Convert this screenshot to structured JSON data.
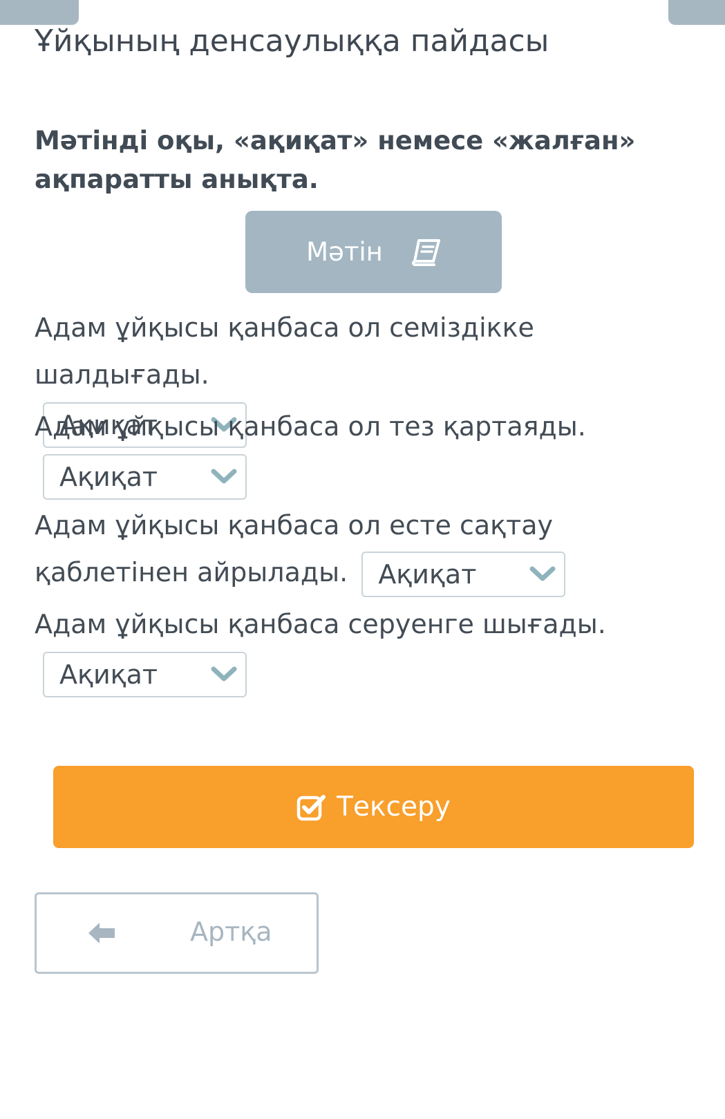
{
  "page": {
    "title": "Ұйқының денсаулыққа пайдасы",
    "instruction": "Мәтінді оқы, «ақиқат» немесе «жалған» ақпаратты анықта."
  },
  "text_button": {
    "label": "Мәтін",
    "icon": "book-icon"
  },
  "questions": [
    {
      "text": "Адам ұйқысы қанбаса ол семіздікке шалдығады.",
      "answer": "Ақиқат"
    },
    {
      "text": "Адам ұйқысы қанбаса ол тез қартаяды.",
      "answer": "Ақиқат"
    },
    {
      "text": "Адам ұйқысы қанбаса ол есте сақтау қаблетінен айрылады.",
      "answer": "Ақиқат"
    },
    {
      "text": "Адам ұйқысы қанбаса серуенге шығады.",
      "answer": "Ақиқат"
    }
  ],
  "check_button": {
    "label": "Тексеру",
    "icon": "check-square-icon"
  },
  "back_button": {
    "label": "Артқа",
    "icon": "arrow-left-icon"
  },
  "colors": {
    "accent_orange": "#f89f2c",
    "muted_blue_gray": "#a3b6c2",
    "chevron_teal": "#8fb3bd",
    "text_dark": "#414b55"
  }
}
